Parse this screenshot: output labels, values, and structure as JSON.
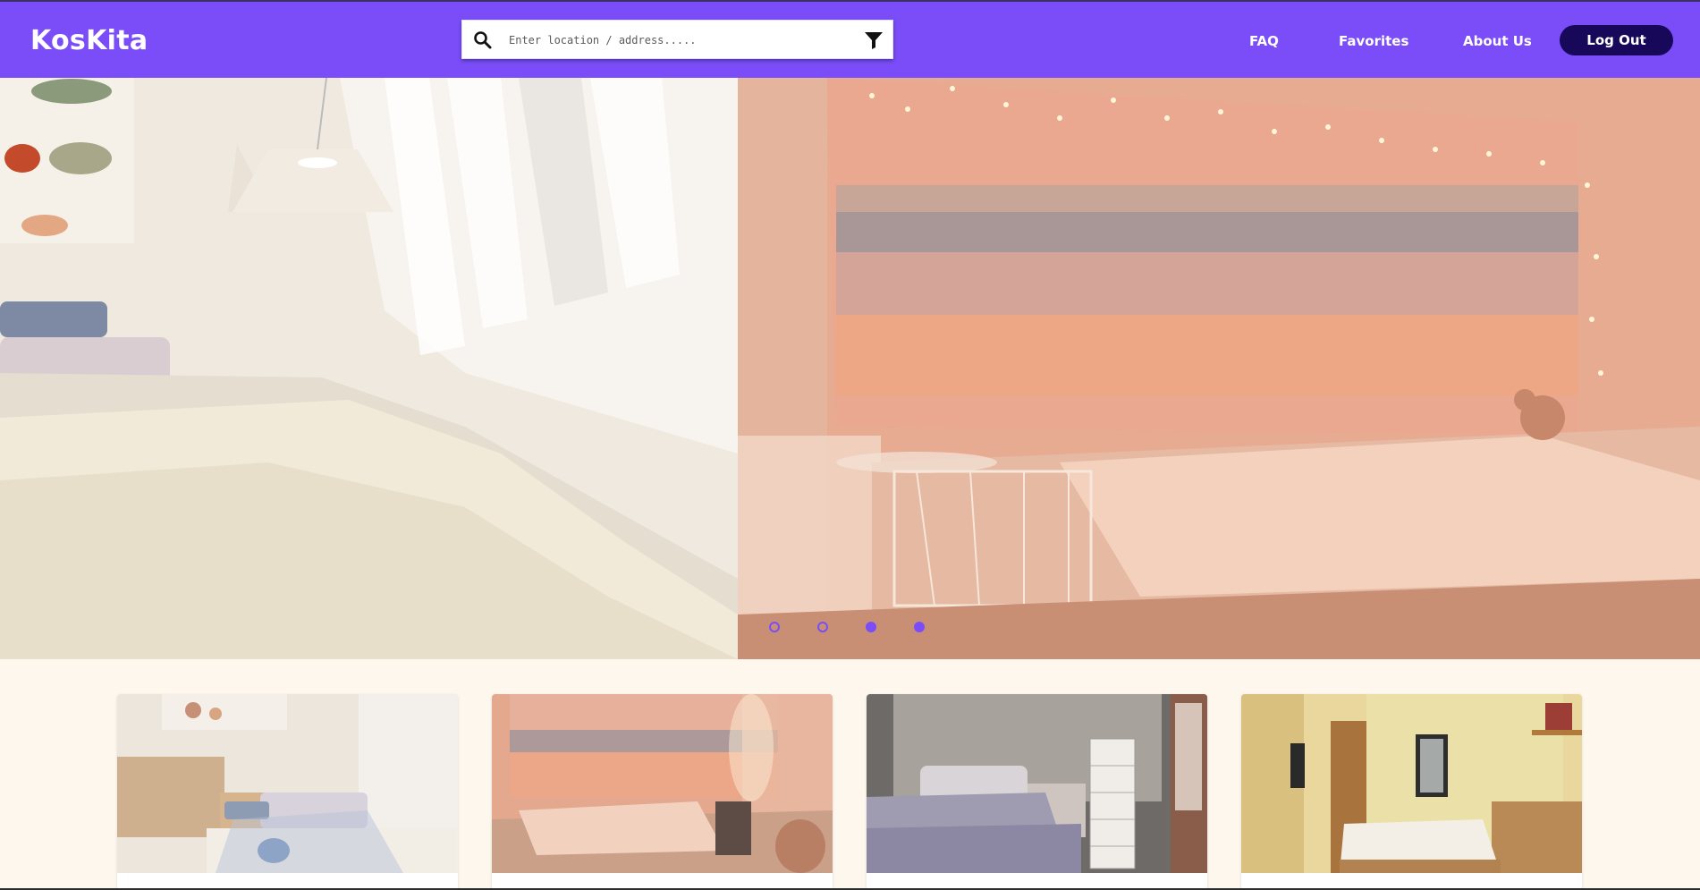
{
  "header": {
    "logo": "KosKita",
    "search": {
      "placeholder": "Enter location / address.....",
      "value": ""
    },
    "nav": [
      {
        "label": "FAQ"
      },
      {
        "label": "Favorites"
      },
      {
        "label": "About Us"
      }
    ],
    "logout_label": "Log Out"
  },
  "carousel": {
    "slides": [
      {
        "description": "bright bedroom with pastel bedding and window light"
      },
      {
        "description": "peach-toned bedroom with beach tapestry and fairy lights"
      }
    ],
    "indicators": [
      {
        "active": false
      },
      {
        "active": false
      },
      {
        "active": true
      },
      {
        "active": true
      }
    ]
  },
  "listings": [
    {
      "description": "pastel bedroom with wooden shelf"
    },
    {
      "description": "peach bedroom with fairy lights and teddy bear"
    },
    {
      "description": "grey bedroom with white drawer cart"
    },
    {
      "description": "yellow-walled room with wardrobe and desk"
    }
  ],
  "colors": {
    "brand": "#7a4df9",
    "logout_bg": "#17085a",
    "page_bg": "#fdf7ee"
  },
  "icons": [
    "search-icon",
    "filter-icon"
  ]
}
